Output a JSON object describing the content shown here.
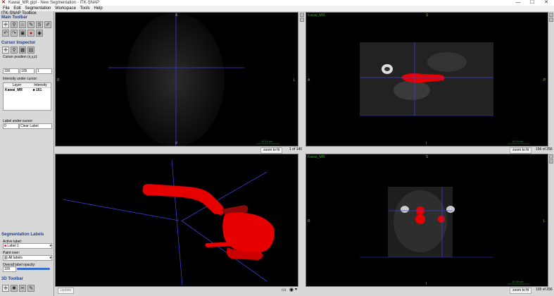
{
  "window": {
    "title": "Kawai_MR.gipl - New Segmentation - ITK-SNAP",
    "minimize": "—",
    "maximize": "☐",
    "close": "✕"
  },
  "menu": [
    "File",
    "Edit",
    "Segmentation",
    "Workspace",
    "Tools",
    "Help"
  ],
  "toolbox": {
    "title": "ITK-SNAP Toolbox",
    "main_toolbar": "Main Toolbar",
    "cursor_inspector": "Cursor Inspector",
    "cursor_position_label": "Cursor position (x,y,z):",
    "cursor_x": "156",
    "cursor_y": "105",
    "cursor_z": "1",
    "intensity_label": "Intensity under cursor:",
    "table_headers": [
      "Layer",
      "Intensity"
    ],
    "table_rows": [
      {
        "layer": "Kawai_MR",
        "intensity": "161"
      }
    ],
    "label_under_cursor": "Label under cursor:",
    "label_id": "0",
    "label_name": "Clear Label",
    "seg_labels_title": "Segmentation Labels",
    "active_label_caption": "Active label:",
    "active_label": "Label 1",
    "paint_over_caption": "Paint over:",
    "paint_over": "All labels",
    "opacity_caption": "Overall label opacity:",
    "opacity_value": "100",
    "toolbar_3d": "3D Toolbar"
  },
  "views": {
    "top_left": {
      "label": "",
      "slice": "1 of 140",
      "zoom_btn": "zoom to fit",
      "scale": "10.10 cm",
      "orient": {
        "top": "A",
        "bottom": "P",
        "left": "R",
        "right": "L"
      }
    },
    "top_right": {
      "label": "Kawai_MR",
      "slice": "156 of 256",
      "zoom_btn": "zoom to fit",
      "scale": "10.10 cm",
      "orient": {
        "top": "S",
        "bottom": "I",
        "left": "A",
        "right": "P"
      }
    },
    "bottom_right": {
      "label": "Kawai_MR",
      "slice": "105 of 256",
      "zoom_btn": "zoom to fit",
      "scale": "10.10 cm",
      "orient": {
        "top": "S",
        "bottom": "I",
        "left": "R",
        "right": "L"
      }
    },
    "bottom_left": {
      "update_btn": "update"
    }
  },
  "colors": {
    "label_red": "#e60000",
    "crosshair": "#3b3bd8",
    "accent": "#1c3e8a"
  },
  "icons": [
    "crosshair-icon",
    "zoom-icon",
    "polygon-icon",
    "paintbrush-icon",
    "snake-icon",
    "annotation-icon",
    "undo-icon",
    "redo-icon",
    "layer-icon",
    "segment-icon",
    "camera-icon",
    "expand-icon"
  ]
}
